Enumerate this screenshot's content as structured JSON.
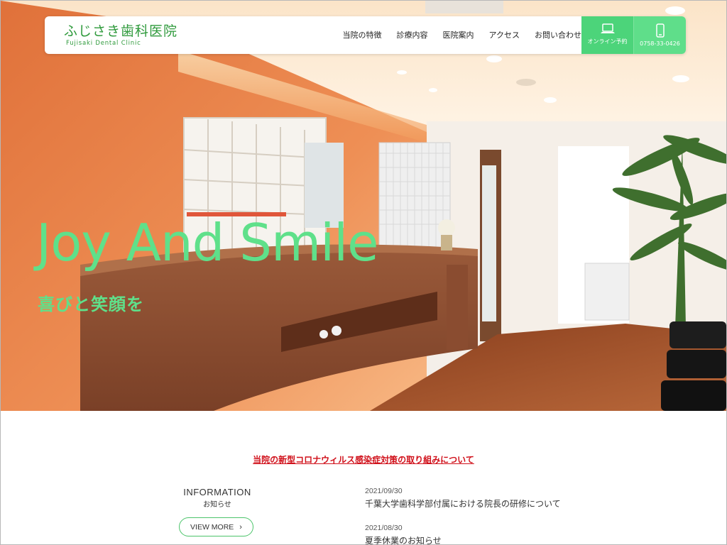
{
  "header": {
    "logo_jp": "ふじさき歯科医院",
    "logo_en": "Fujisaki Dental Clinic",
    "nav": [
      {
        "label": "当院の特徴"
      },
      {
        "label": "診療内容"
      },
      {
        "label": "医院案内"
      },
      {
        "label": "アクセス"
      },
      {
        "label": "お問い合わせ"
      }
    ],
    "online_label": "オンライン予約",
    "online_icon": "laptop-icon",
    "phone_label": "0758-33-0426",
    "phone_icon": "smartphone-icon"
  },
  "hero": {
    "title": "Joy And Smile",
    "subtitle": "喜びと笑顔を"
  },
  "notice": {
    "link": "当院の新型コロナウィルス感染症対策の取り組みについて"
  },
  "information": {
    "title": "INFORMATION",
    "subtitle": "お知らせ",
    "view_more": "VIEW MORE",
    "items": [
      {
        "date": "2021/09/30",
        "title": "千葉大学歯科学部付属における院長の研修について"
      },
      {
        "date": "2021/08/30",
        "title": "夏季休業のお知らせ"
      }
    ]
  },
  "colors": {
    "brand_green": "#2f9a3c",
    "accent_green": "#5fe08a",
    "notice_red": "#d0101a"
  }
}
